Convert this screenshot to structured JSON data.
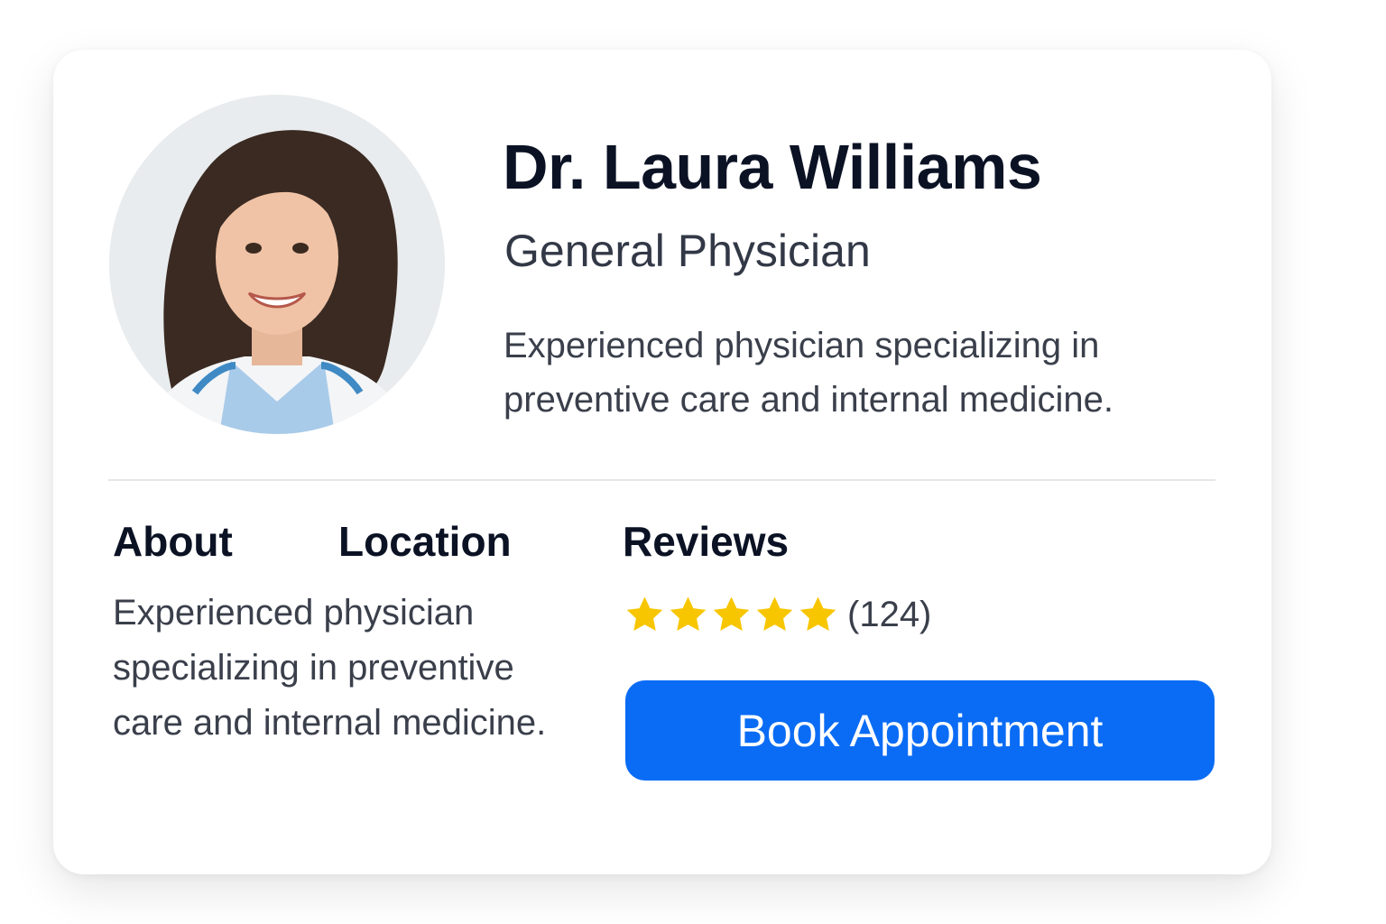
{
  "profile": {
    "name": "Dr. Laura Williams",
    "specialty": "General Physician",
    "bio": "Experienced physician specializing in preventive care and internal medicine."
  },
  "tabs": [
    {
      "label": "About"
    },
    {
      "label": "Location"
    }
  ],
  "about": {
    "text": "Experienced physician specializing in preventive care and internal medicine."
  },
  "reviews": {
    "title": "Reviews",
    "rating": 5,
    "max_rating": 5,
    "count_label": "(124)",
    "star_color": "#f7c600"
  },
  "actions": {
    "book_label": "Book Appointment",
    "book_color": "#0a6cf5"
  }
}
